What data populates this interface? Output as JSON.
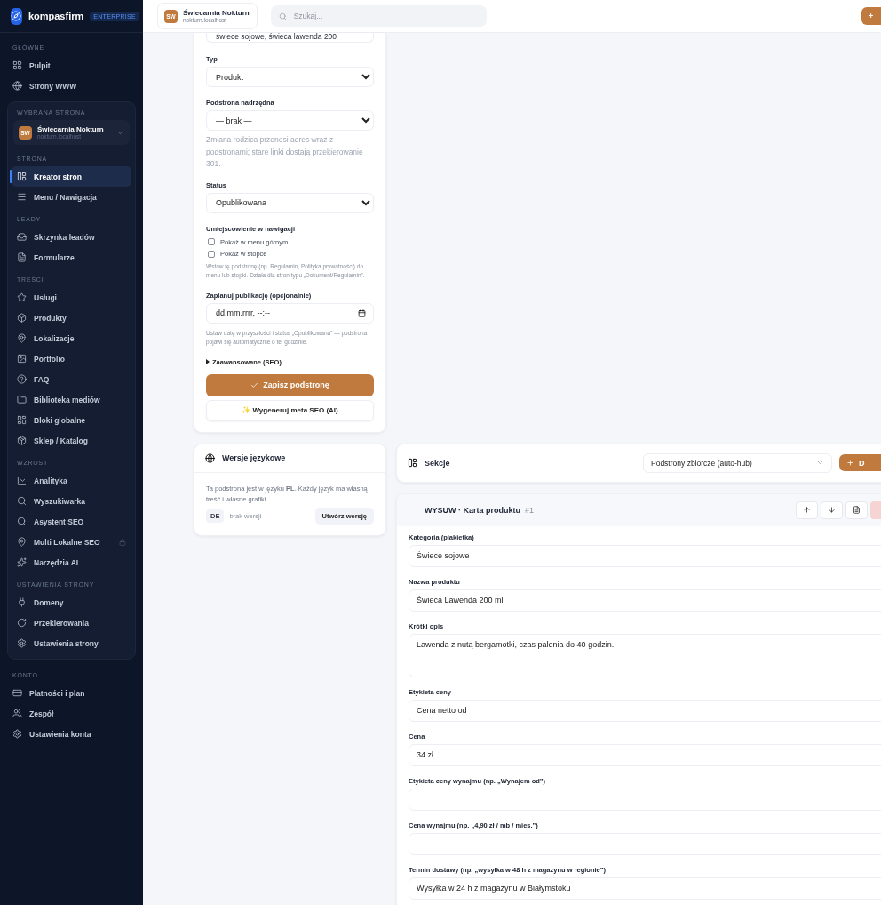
{
  "brand": {
    "name": "kompasfirm",
    "badge": "ENTERPRISE"
  },
  "sidebar": {
    "groups": [
      {
        "heading": "GŁÓWNE",
        "items": [
          {
            "label": "Pulpit",
            "selected": false,
            "locked": false
          },
          {
            "label": "Strony WWW",
            "selected": false,
            "locked": false
          }
        ]
      }
    ],
    "site_panel": {
      "heading": "WYBRANA STRONA",
      "site": {
        "initials": "SW",
        "name": "Świecarnia Nokturn",
        "host": "nokturn.localhost"
      },
      "groups": [
        {
          "heading": "STRONA",
          "items": [
            {
              "label": "Kreator stron",
              "selected": true,
              "locked": false
            },
            {
              "label": "Menu / Nawigacja",
              "selected": false,
              "locked": false
            }
          ]
        },
        {
          "heading": "LEADY",
          "items": [
            {
              "label": "Skrzynka leadów",
              "selected": false,
              "locked": false
            },
            {
              "label": "Formularze",
              "selected": false,
              "locked": false
            }
          ]
        },
        {
          "heading": "TREŚCI",
          "items": [
            {
              "label": "Usługi",
              "selected": false,
              "locked": false
            },
            {
              "label": "Produkty",
              "selected": false,
              "locked": false
            },
            {
              "label": "Lokalizacje",
              "selected": false,
              "locked": false
            },
            {
              "label": "Portfolio",
              "selected": false,
              "locked": false
            },
            {
              "label": "FAQ",
              "selected": false,
              "locked": false
            },
            {
              "label": "Biblioteka mediów",
              "selected": false,
              "locked": false
            },
            {
              "label": "Bloki globalne",
              "selected": false,
              "locked": false
            },
            {
              "label": "Sklep / Katalog",
              "selected": false,
              "locked": false
            }
          ]
        },
        {
          "heading": "WZROST",
          "items": [
            {
              "label": "Analityka",
              "selected": false,
              "locked": false
            },
            {
              "label": "Wyszukiwarka",
              "selected": false,
              "locked": false
            },
            {
              "label": "Asystent SEO",
              "selected": false,
              "locked": false
            },
            {
              "label": "Multi Lokalne SEO",
              "selected": false,
              "locked": true
            },
            {
              "label": "Narzędzia AI",
              "selected": false,
              "locked": false
            }
          ]
        },
        {
          "heading": "USTAWIENIA STRONY",
          "items": [
            {
              "label": "Domeny",
              "selected": false,
              "locked": false
            },
            {
              "label": "Przekierowania",
              "selected": false,
              "locked": false
            },
            {
              "label": "Ustawienia strony",
              "selected": false,
              "locked": false
            }
          ]
        }
      ]
    },
    "account": {
      "heading": "KONTO",
      "items": [
        {
          "label": "Płatności i plan",
          "selected": false,
          "locked": false
        },
        {
          "label": "Zespół",
          "selected": false,
          "locked": false
        },
        {
          "label": "Ustawienia konta",
          "selected": false,
          "locked": false
        }
      ]
    }
  },
  "header": {
    "site": {
      "initials": "SW",
      "name": "Świecarnia Nokturn",
      "host": "nokturn.localhost"
    },
    "search": {
      "placeholder": "Szukaj..."
    },
    "add_button": "+"
  },
  "page_form": {
    "top_field": {
      "value": "świece sojowe, świeca lawenda 200"
    },
    "type": {
      "label": "Typ",
      "value": "Produkt"
    },
    "parent": {
      "label": "Podstrona nadrzędna",
      "value": "— brak —",
      "help": "Zmiana rodzica przenosi adres wraz z podstronami; stare linki dostają przekierowanie 301."
    },
    "status": {
      "label": "Status",
      "value": "Opublikowana"
    },
    "navigation": {
      "label": "Umiejscowienie w nawigacji",
      "options": [
        {
          "label": "Pokaż w menu górnym",
          "checked": false
        },
        {
          "label": "Pokaż w stopce",
          "checked": false
        }
      ],
      "help": "Wstaw tę podstronę (np. Regulamin, Polityka prywatności) do menu lub stopki. Działa dla stron typu „Dokument/Regulamin”."
    },
    "schedule": {
      "label": "Zaplanuj publikację (opcjonalnie)",
      "placeholder": "dd.mm.rrrr, --:--",
      "help": "Ustaw datę w przyszłości i status „Opublikowana” — podstrona pojawi się automatycznie o tej godzinie."
    },
    "advanced": {
      "label": "Zaawansowane (SEO)",
      "expanded": false
    },
    "save_button": "Zapisz podstronę",
    "ai_button": "✨ Wygeneruj meta SEO (AI)"
  },
  "languages": {
    "title": "Wersje językowe",
    "text": "Ta podstrona jest w języku **PL**. Każdy język ma własną treść i własne grafiki.",
    "rows": [
      {
        "code": "DE",
        "status": "brak wersji",
        "button": "Utwórz wersję"
      }
    ]
  },
  "sections": {
    "title": "Sekcje",
    "select": "Podstrony zbiorcze (auto-hub)",
    "add_button": "D"
  },
  "section_card": {
    "title": "WYSUW · Karta produktu",
    "number": "#1",
    "fields": [
      {
        "kind": "input",
        "label": "Kategoria (plakietka)",
        "value": "Świece sojowe"
      },
      {
        "kind": "input",
        "label": "Nazwa produktu",
        "value": "Świeca Lawenda 200 ml"
      },
      {
        "kind": "textarea",
        "label": "Krótki opis",
        "value": "Lawenda z nutą bergamotki, czas palenia do 40 godzin."
      },
      {
        "kind": "input",
        "label": "Etykieta ceny",
        "value": "Cena netto od"
      },
      {
        "kind": "input",
        "label": "Cena",
        "value": "34 zł"
      },
      {
        "kind": "input",
        "label": "Etykieta ceny wynajmu (np. „Wynajem od”)"
      },
      {
        "kind": "input",
        "label": "Cena wynajmu (np. „4,90 zł / mb / mies.”)"
      },
      {
        "kind": "input",
        "label": "Termin dostawy (np. „wysyłka w 48 h z magazynu w regionie”)",
        "value": "Wysyłka w 24 h z magazynu w Białymstoku"
      }
    ]
  }
}
